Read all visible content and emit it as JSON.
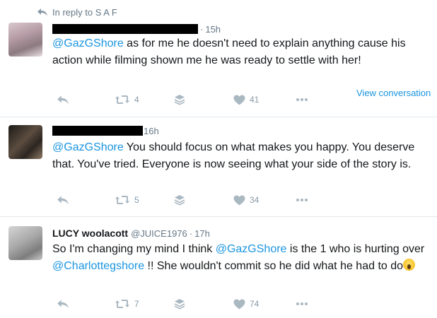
{
  "reply_context": {
    "label": "In reply to S A F"
  },
  "tweets": [
    {
      "display_name": "",
      "screen_name": "",
      "separator": "·",
      "time": "15h",
      "mention": "@GazGShore",
      "text": " as for me he doesn't need to explain anything cause his action while filming shown me he was ready to settle with her!",
      "retweets": "4",
      "likes": "41",
      "view_conversation": "View conversation"
    },
    {
      "display_name": "",
      "screen_name": "",
      "separator": "",
      "time": "16h",
      "mention": "@GazGShore",
      "text": " You should focus on what makes you happy. You deserve that. You've tried. Everyone is now seeing what your side of the story is.",
      "retweets": "5",
      "likes": "34"
    },
    {
      "display_name": "LUCY woolacott",
      "screen_name": "@JUICE1976",
      "separator": "·",
      "time": "17h",
      "text_a": "So I'm changing my mind I think ",
      "mention_a": "@GazGShore",
      "text_b": " is the 1 who is hurting over ",
      "mention_b": "@Charlottegshore",
      "text_c": " !! She wouldn't commit so he did what he had to do",
      "retweets": "7",
      "likes": "74"
    }
  ],
  "icons": {
    "reply": "reply-arrow-icon",
    "retweet": "retweet-icon",
    "stack": "stack-layers-icon",
    "like": "heart-icon",
    "more": "more-dots-icon",
    "emoji": "screaming-face-emoji"
  },
  "colors": {
    "link": "#1b95e0",
    "icon": "#aab8c2",
    "muted": "#657786",
    "text": "#14171a",
    "divider": "#e1e8ed"
  }
}
